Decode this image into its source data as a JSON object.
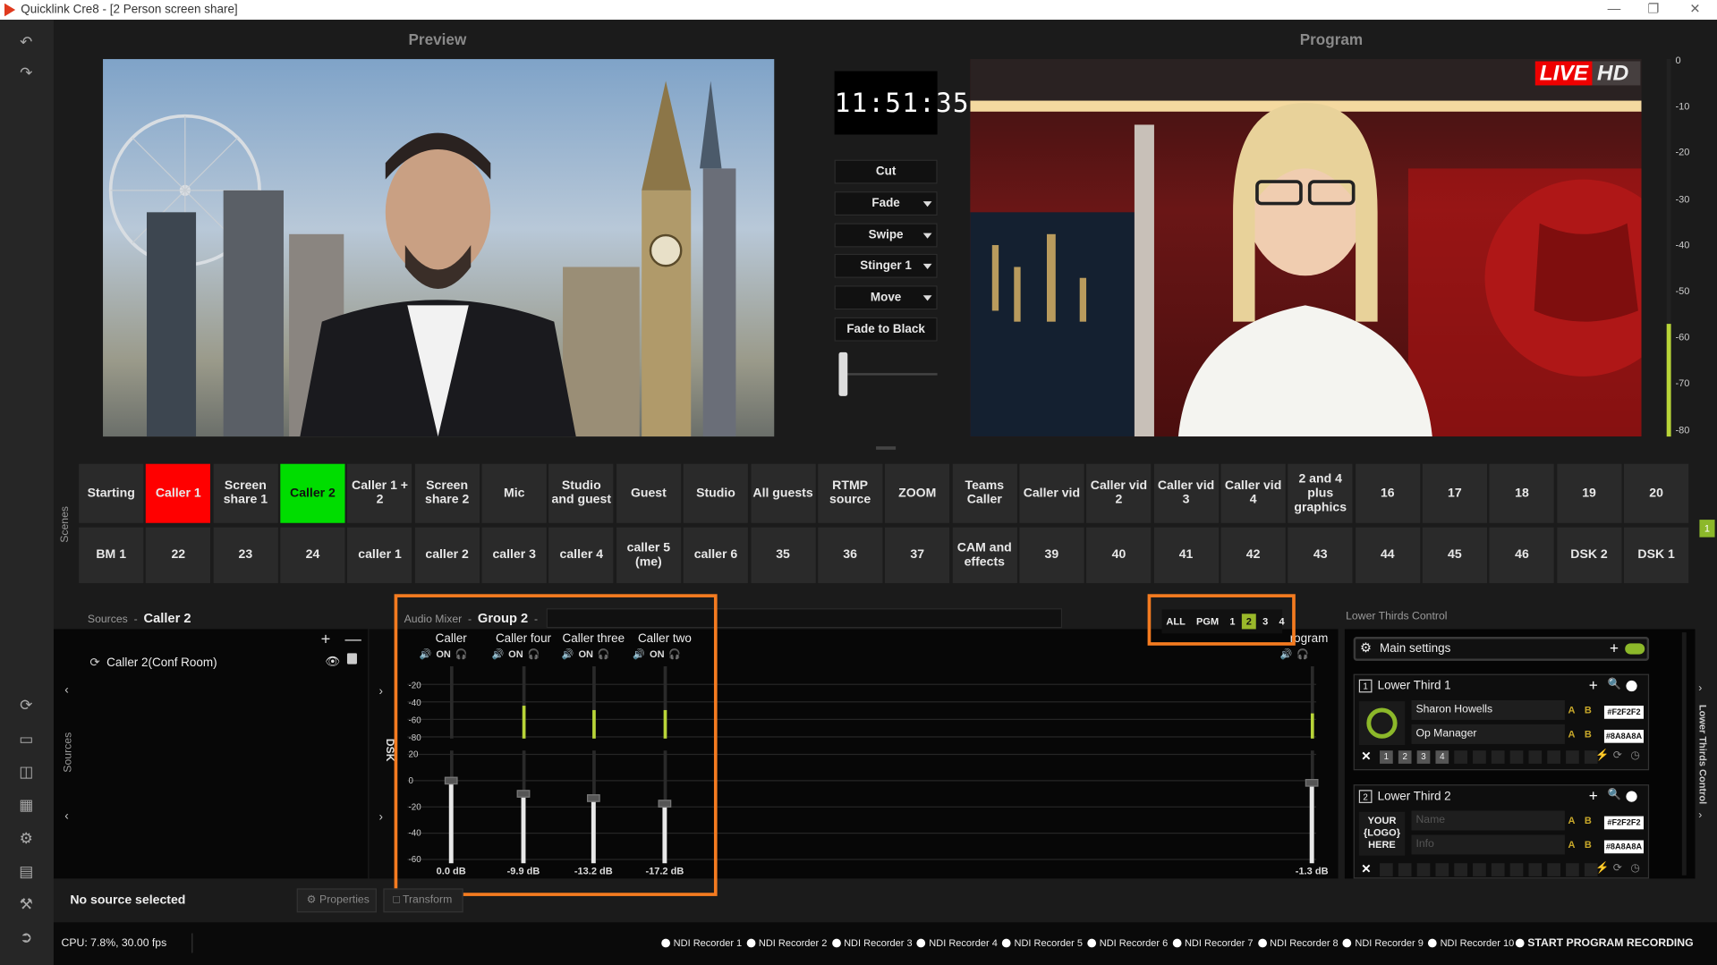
{
  "window": {
    "title": "Quicklink Cre8  -  [2 Person screen share]"
  },
  "headings": {
    "preview": "Preview",
    "program": "Program"
  },
  "clock": "11:51:35",
  "transitions": {
    "cut": "Cut",
    "fade": "Fade",
    "swipe": "Swipe",
    "stinger": "Stinger 1",
    "move": "Move",
    "fade_black": "Fade to Black"
  },
  "program_badge": {
    "live": "LIVE",
    "hd": "HD"
  },
  "meter_ticks": [
    "0",
    "-10",
    "-20",
    "-30",
    "-40",
    "-50",
    "-60",
    "-70",
    "-80"
  ],
  "program_meter_level": 0.3,
  "scenes_label": "Scenes",
  "scenes_row1": [
    "Starting",
    "Caller 1",
    "Screen share 1",
    "Caller 2",
    "Caller 1 + 2",
    "Screen share 2",
    "Mic",
    "Studio and guest",
    "Guest",
    "Studio",
    "All guests",
    "RTMP source",
    "ZOOM",
    "Teams Caller",
    "Caller vid",
    "Caller vid 2",
    "Caller vid 3",
    "Caller vid 4",
    "2 and 4 plus graphics",
    "16",
    "17",
    "18",
    "19",
    "20"
  ],
  "scenes_row2": [
    "BM 1",
    "22",
    "23",
    "24",
    "caller 1",
    "caller 2",
    "caller 3",
    "caller 4",
    "caller 5 (me)",
    "caller 6",
    "35",
    "36",
    "37",
    "CAM and effects",
    "39",
    "40",
    "41",
    "42",
    "43",
    "44",
    "45",
    "46",
    "DSK 2",
    "DSK 1"
  ],
  "scenes_badge": "1",
  "sources": {
    "label": "Sources",
    "selected": "Caller 2",
    "item": "Caller 2(Conf Room)",
    "side_label": "Sources",
    "no_selection": "No source selected",
    "properties": "Properties",
    "transform": "Transform"
  },
  "dsk_label": "DSK",
  "mixer": {
    "label": "Audio Mixer",
    "group": "Group 2",
    "on_label": "ON",
    "filters": [
      "ALL",
      "PGM",
      "1",
      "2",
      "3",
      "4"
    ],
    "active_filter": "2",
    "meter_scale": [
      "-20",
      "-40",
      "-60",
      "-80"
    ],
    "fader_scale": [
      "20",
      "0",
      "-20",
      "-40",
      "-60"
    ],
    "channels": [
      {
        "name": "Caller",
        "db": "0.0 dB",
        "db_value": 0.0,
        "level": 0
      },
      {
        "name": "Caller four",
        "db": "-9.9 dB",
        "db_value": -9.9,
        "level": 0.45
      },
      {
        "name": "Caller three",
        "db": "-13.2 dB",
        "db_value": -13.2,
        "level": 0.4
      },
      {
        "name": "Caller two",
        "db": "-17.2 dB",
        "db_value": -17.2,
        "level": 0.4
      }
    ],
    "program": {
      "name": "rogram",
      "db": "-1.3 dB",
      "db_value": -1.3,
      "level": 0.35
    }
  },
  "lower_thirds": {
    "panel_label": "Lower Thirds Control",
    "side_label": "Lower Thirds Control",
    "main_settings": "Main settings",
    "items": [
      {
        "number": "1",
        "title": "Lower Third 1",
        "name": "Sharon Howells",
        "info": "Op Manager",
        "name_color": "#F2F2F2",
        "info_color": "#8A8A8A",
        "slots": [
          "1",
          "2",
          "3",
          "4"
        ]
      },
      {
        "number": "2",
        "title": "Lower Third 2",
        "name": "Name",
        "info": "Info",
        "name_color": "#F2F2F2",
        "info_color": "#8A8A8A",
        "logo": "YOUR {LOGO} HERE"
      }
    ]
  },
  "status": {
    "cpu": "CPU: 7.8%, 30.00 fps"
  },
  "recorders": [
    "NDI Recorder 1",
    "NDI Recorder 2",
    "NDI Recorder 3",
    "NDI Recorder 4",
    "NDI Recorder 5",
    "NDI Recorder 6",
    "NDI Recorder 7",
    "NDI Recorder 8",
    "NDI Recorder 9",
    "NDI Recorder 10"
  ],
  "start_recording": "START PROGRAM RECORDING"
}
